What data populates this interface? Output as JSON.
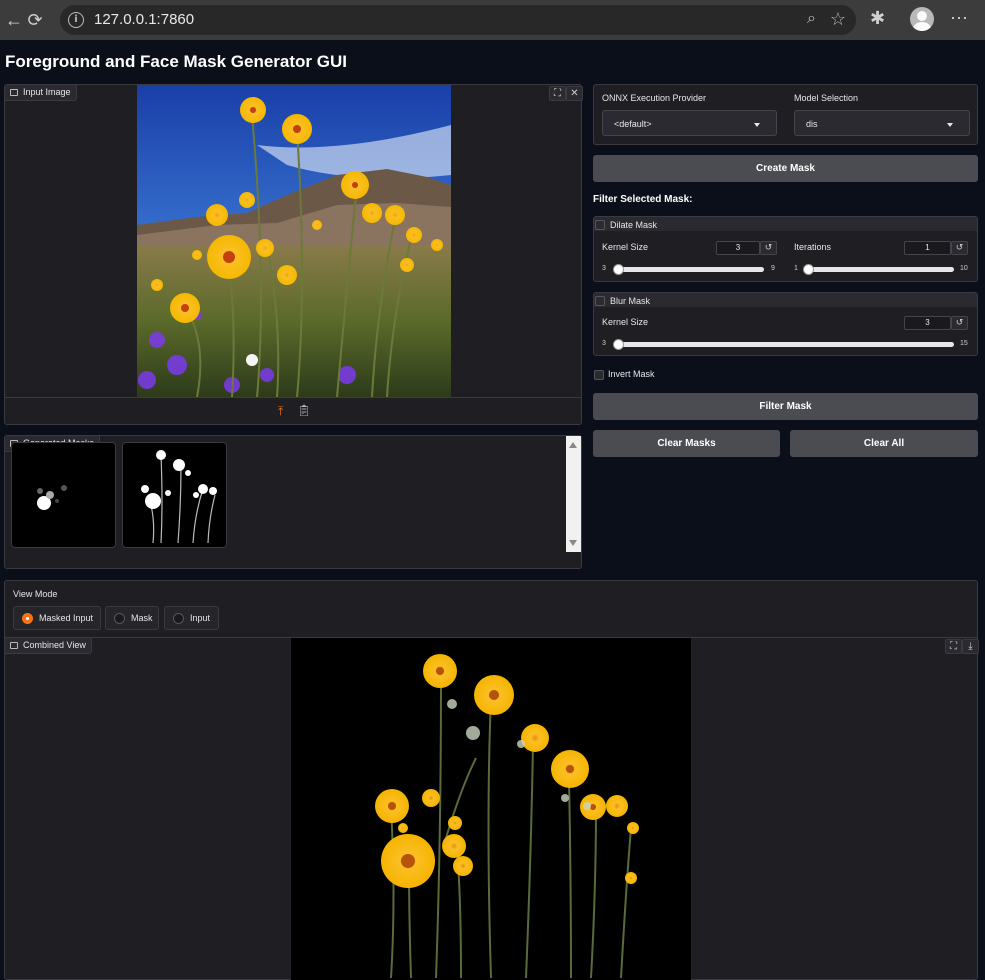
{
  "browser": {
    "url": "127.0.0.1:7860"
  },
  "page": {
    "title": "Foreground and Face Mask Generator GUI"
  },
  "input_image": {
    "label": "Input Image"
  },
  "generated_masks": {
    "label": "Generated Masks"
  },
  "settings": {
    "provider_label": "ONNX Execution Provider",
    "provider_value": "<default>",
    "model_label": "Model Selection",
    "model_value": "dis",
    "create_mask_label": "Create Mask",
    "filter_heading": "Filter Selected Mask:"
  },
  "dilate": {
    "title": "Dilate Mask",
    "kernel_label": "Kernel Size",
    "kernel_value": "3",
    "kernel_min": "3",
    "kernel_max": "9",
    "iter_label": "Iterations",
    "iter_value": "1",
    "iter_min": "1",
    "iter_max": "10"
  },
  "blur": {
    "title": "Blur Mask",
    "kernel_label": "Kernel Size",
    "kernel_value": "3",
    "kernel_min": "3",
    "kernel_max": "15"
  },
  "invert": {
    "label": "Invert Mask"
  },
  "actions": {
    "filter_mask": "Filter Mask",
    "clear_masks": "Clear Masks",
    "clear_all": "Clear All"
  },
  "view_mode": {
    "label": "View Mode",
    "options": [
      "Masked Input",
      "Mask",
      "Input"
    ],
    "selected": "Masked Input"
  },
  "combined_view": {
    "label": "Combined View"
  },
  "colors": {
    "background": "#0b0f19",
    "panel": "#1f1f23",
    "button": "#4b4b52",
    "accent": "#f97316"
  }
}
